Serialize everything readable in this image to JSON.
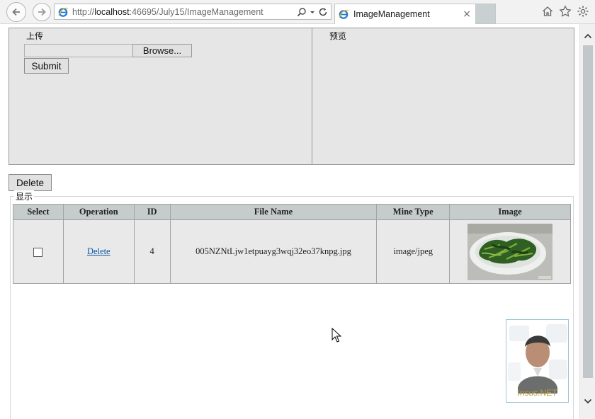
{
  "browser": {
    "url_prefix": "http://",
    "url_host": "localhost",
    "url_rest": ":46695/July15/ImageManagement",
    "tab_title": "ImageManagement",
    "tab_close": "×",
    "icons": [
      "back-arrow-icon",
      "forward-arrow-icon",
      "ie-logo-icon",
      "search-icon",
      "dropdown-icon",
      "refresh-icon",
      "home-icon",
      "star-icon",
      "gear-icon"
    ]
  },
  "upload_panel": {
    "title": "上传",
    "browse_label": "Browse...",
    "submit_label": "Submit"
  },
  "preview_panel": {
    "title": "预览"
  },
  "toolbar": {
    "delete_label": "Delete"
  },
  "display_section": {
    "title": "显示"
  },
  "grid": {
    "headers": [
      "Select",
      "Operation",
      "ID",
      "File Name",
      "Mine Type",
      "Image"
    ],
    "rows": [
      {
        "selected": false,
        "operation": "Delete",
        "id": "4",
        "file_name": "005NZNtLjw1etpuayg3wqj32eo37knpg.jpg",
        "mime_type": "image/jpeg",
        "image": "plate-of-greens-thumbnail"
      }
    ]
  },
  "watermark": {
    "label": "Insus.NET"
  },
  "colors": {
    "panel_bg": "#e6e6e6",
    "header_bg": "#c6cbcc",
    "link": "#0a57a5",
    "scroll_thumb": "#c2c7c9"
  }
}
